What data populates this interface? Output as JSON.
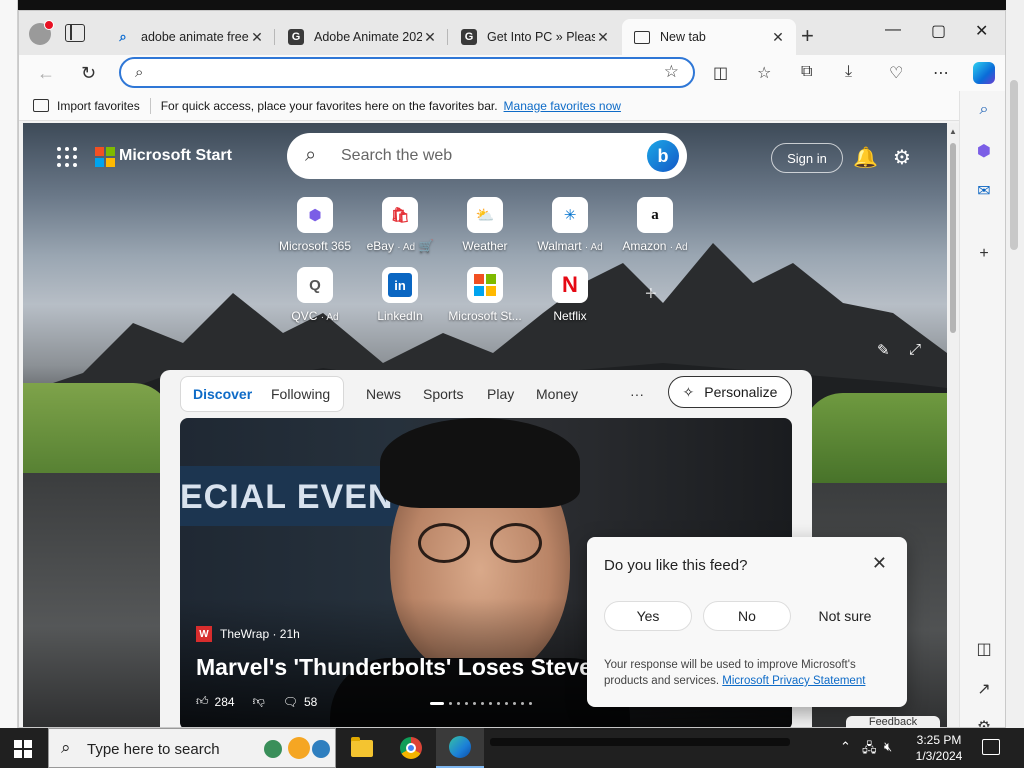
{
  "tabs": [
    {
      "title": "adobe animate free",
      "favicon": "search-icon"
    },
    {
      "title": "Adobe Animate 202...",
      "favicon": "g-favicon"
    },
    {
      "title": "Get Into PC » Please...",
      "favicon": "g-favicon"
    },
    {
      "title": "New tab",
      "favicon": "new-tab-icon",
      "active": true
    }
  ],
  "toolbar": {
    "address_value": ""
  },
  "favorites_bar": {
    "import_label": "Import favorites",
    "hint": "For quick access, place your favorites here on the favorites bar.",
    "manage_link": "Manage favorites now"
  },
  "start": {
    "brand": "Microsoft Start",
    "search_placeholder": "Search the web",
    "sign_in": "Sign in"
  },
  "quick_links": [
    {
      "label": "Microsoft 365",
      "ad": ""
    },
    {
      "label": "eBay",
      "ad": "· Ad"
    },
    {
      "label": "Weather",
      "ad": ""
    },
    {
      "label": "Walmart",
      "ad": "· Ad"
    },
    {
      "label": "Amazon",
      "ad": "· Ad"
    },
    {
      "label": "QVC",
      "ad": "· Ad"
    },
    {
      "label": "LinkedIn",
      "ad": ""
    },
    {
      "label": "Microsoft St...",
      "ad": ""
    },
    {
      "label": "Netflix",
      "ad": ""
    }
  ],
  "feed": {
    "tabs": [
      "Discover",
      "Following",
      "News",
      "Sports",
      "Play",
      "Money"
    ],
    "more": "···",
    "personalize": "Personalize",
    "hero": {
      "banner_text": "ECIAL EVEN",
      "source": "TheWrap · 21h",
      "headline": "Marvel's 'Thunderbolts' Loses Steven",
      "likes": "284",
      "comments": "58"
    }
  },
  "popup": {
    "question": "Do you like this feed?",
    "options": [
      "Yes",
      "No",
      "Not sure"
    ],
    "note": "Your response will be used to improve Microsoft's products and services.",
    "link": "Microsoft Privacy Statement"
  },
  "feedback": "Feedback",
  "taskbar": {
    "search_placeholder": "Type here to search",
    "time": "3:25 PM",
    "date": "1/3/2024"
  },
  "colors": {
    "accent": "#0e6bc7",
    "address_border": "#2f77d6",
    "taskbar": "#202020"
  }
}
